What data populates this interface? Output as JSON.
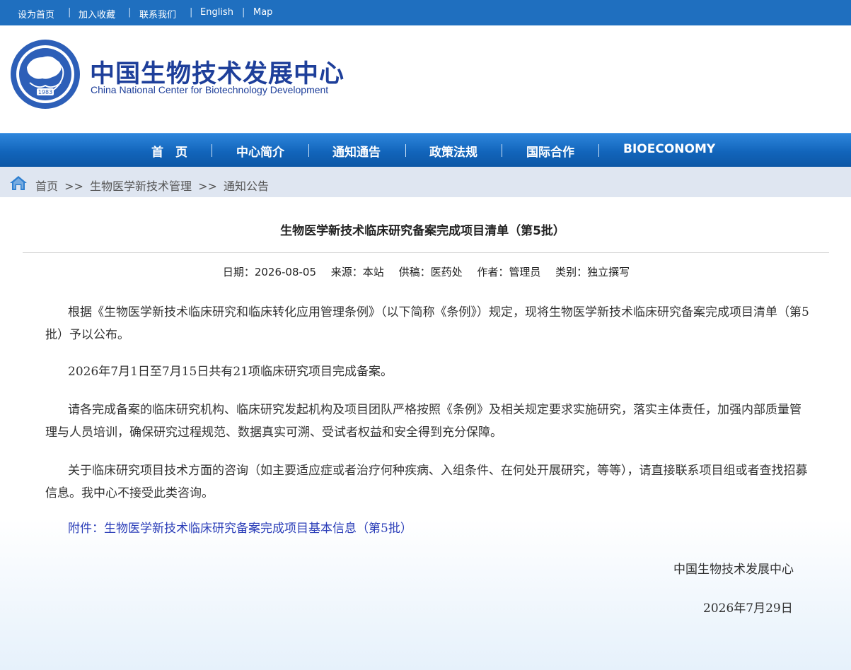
{
  "topbar": {
    "links": [
      "设为首页",
      "加入收藏",
      "联系我们",
      "English",
      "Map"
    ]
  },
  "logo": {
    "name_cn": "中国生物技术发展中心",
    "name_en": "China National Center for Biotechnology Development",
    "emblem_year": "1983"
  },
  "nav": {
    "items": [
      "首　页",
      "中心简介",
      "通知通告",
      "政策法规",
      "国际合作",
      "BIOECONOMY"
    ]
  },
  "breadcrumb": {
    "items": [
      "首页",
      ">>",
      "生物医学新技术管理",
      ">>",
      "通知公告"
    ]
  },
  "article": {
    "title": "生物医学新技术临床研究备案完成项目清单（第5批）",
    "meta": {
      "date": "日期：2026-08-05",
      "source": "来源：本站",
      "contributor": "供稿：医药处",
      "author": "作者：管理员",
      "category": "类别：独立撰写"
    },
    "paragraphs": [
      "根据《生物医学新技术临床研究和临床转化应用管理条例》（以下简称《条例》）规定，现将生物医学新技术临床研究备案完成项目清单（第5批）予以公布。",
      "2026年7月1日至7月15日共有21项临床研究项目完成备案。",
      "请各完成备案的临床研究机构、临床研究发起机构及项目团队严格按照《条例》及相关规定要求实施研究，落实主体责任，加强内部质量管理与人员培训，确保研究过程规范、数据真实可溯、受试者权益和安全得到充分保障。",
      "关于临床研究项目技术方面的咨询（如主要适应症或者治疗何种疾病、入组条件、在何处开展研究，等等），请直接联系项目组或者查找招募信息。我中心不接受此类咨询。"
    ],
    "attachment": "附件：生物医学新技术临床研究备案完成项目基本信息（第5批）",
    "signature": "中国生物技术发展中心",
    "sign_date": "2026年7月29日"
  },
  "colors": {
    "topbar": "#1f6fbf",
    "nav": "#1265bb",
    "crumbbar": "#dfe6f1",
    "logo_text": "#1e3f9a",
    "link": "#2a3db8"
  }
}
